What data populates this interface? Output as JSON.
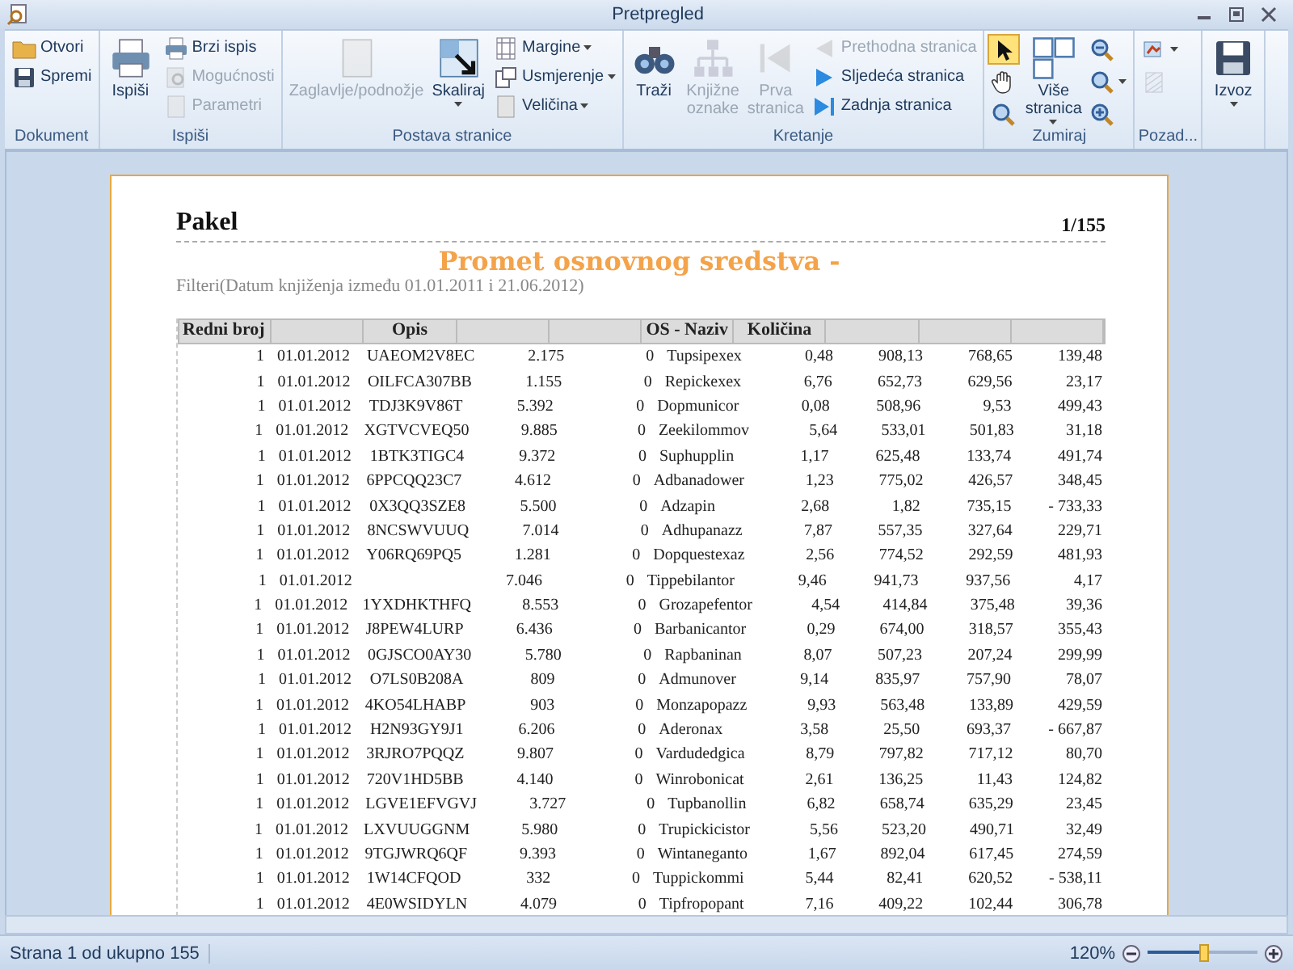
{
  "window": {
    "title": "Pretpregled"
  },
  "ribbon": {
    "groups": [
      {
        "label": "Dokument",
        "items": [
          {
            "kind": "small",
            "label": "Otvori",
            "disabled": false,
            "dropdown": false
          },
          {
            "kind": "small",
            "label": "Spremi",
            "disabled": false,
            "dropdown": false
          }
        ]
      },
      {
        "label": "Ispiši",
        "items": [
          {
            "kind": "large",
            "label": "Ispiši",
            "disabled": false,
            "dropdown": false
          },
          {
            "kind": "small",
            "label": "Brzi ispis",
            "disabled": false,
            "dropdown": false
          },
          {
            "kind": "small",
            "label": "Mogućnosti",
            "disabled": true,
            "dropdown": false
          },
          {
            "kind": "small",
            "label": "Parametri",
            "disabled": true,
            "dropdown": false
          }
        ]
      },
      {
        "label": "Postava stranice",
        "items": [
          {
            "kind": "large",
            "label": "Zaglavlje/podnožje",
            "disabled": true,
            "dropdown": false
          },
          {
            "kind": "large",
            "label": "Skaliraj",
            "disabled": false,
            "dropdown": true
          },
          {
            "kind": "small",
            "label": "Margine",
            "disabled": false,
            "dropdown": true
          },
          {
            "kind": "small",
            "label": "Usmjerenje",
            "disabled": false,
            "dropdown": true
          },
          {
            "kind": "small",
            "label": "Veličina",
            "disabled": false,
            "dropdown": true
          }
        ]
      },
      {
        "label": "Kretanje",
        "items": [
          {
            "kind": "large",
            "label": "Traži",
            "disabled": false,
            "dropdown": false
          },
          {
            "kind": "large",
            "label": "Knjižne oznake",
            "disabled": true,
            "dropdown": false
          },
          {
            "kind": "large",
            "label": "Prva stranica",
            "disabled": true,
            "dropdown": false
          },
          {
            "kind": "small",
            "label": "Prethodna stranica",
            "disabled": true,
            "dropdown": false
          },
          {
            "kind": "small",
            "label": "Sljedeća stranica",
            "disabled": false,
            "dropdown": false
          },
          {
            "kind": "small",
            "label": "Zadnja stranica",
            "disabled": false,
            "dropdown": false
          }
        ]
      },
      {
        "label": "Zumiraj",
        "items": [
          {
            "kind": "tool",
            "selected": true,
            "disabled": false,
            "dropdown": false
          },
          {
            "kind": "tool",
            "selected": false,
            "disabled": false,
            "dropdown": false
          },
          {
            "kind": "tool",
            "selected": false,
            "disabled": false,
            "dropdown": false
          },
          {
            "kind": "large",
            "label": "Više stranica",
            "disabled": false,
            "dropdown": true
          },
          {
            "kind": "tool",
            "selected": false,
            "disabled": false,
            "dropdown": false
          },
          {
            "kind": "tool",
            "selected": false,
            "disabled": false,
            "dropdown": true
          },
          {
            "kind": "tool",
            "selected": false,
            "disabled": false,
            "dropdown": false
          }
        ]
      },
      {
        "label": "Pozad...",
        "items": [
          {
            "kind": "tool",
            "selected": false,
            "disabled": false,
            "dropdown": true
          },
          {
            "kind": "tool",
            "selected": false,
            "disabled": true,
            "dropdown": false
          }
        ]
      },
      {
        "items": [
          {
            "kind": "large",
            "label": "Izvoz",
            "disabled": false,
            "dropdown": true
          }
        ]
      }
    ]
  },
  "document": {
    "company": "Pakel",
    "page_number": "1/155",
    "title": "Promet osnovnog sredstva -",
    "filter": "Filteri(Datum knjiženja između 01.01.2011 i 21.06.2012)",
    "table": {
      "columns": [
        "Redni broj",
        "",
        "Opis",
        "",
        "",
        "OS - Naziv",
        "Količina",
        "",
        "",
        ""
      ],
      "rows": [
        [
          "1",
          "01.01.2012",
          "UAEOM2V8EC",
          "2.175",
          "0",
          "Tupsipexex",
          "0,48",
          "908,13",
          "768,65",
          "139,48"
        ],
        [
          "1",
          "01.01.2012",
          "OILFCA307BB",
          "1.155",
          "0",
          "Repickexex",
          "6,76",
          "652,73",
          "629,56",
          "23,17"
        ],
        [
          "1",
          "01.01.2012",
          "TDJ3K9V86T",
          "5.392",
          "0",
          "Dopmunicor",
          "0,08",
          "508,96",
          "9,53",
          "499,43"
        ],
        [
          "1",
          "01.01.2012",
          "XGTVCVEQ50",
          "9.885",
          "0",
          "Zeekilommov",
          "5,64",
          "533,01",
          "501,83",
          "31,18"
        ],
        [
          "1",
          "01.01.2012",
          "1BTK3TIGC4",
          "9.372",
          "0",
          "Suphupplin",
          "1,17",
          "625,48",
          "133,74",
          "491,74"
        ],
        [
          "1",
          "01.01.2012",
          "6PPCQQ23C7",
          "4.612",
          "0",
          "Adbanadower",
          "1,23",
          "775,02",
          "426,57",
          "348,45"
        ],
        [
          "1",
          "01.01.2012",
          "0X3QQ3SZE8",
          "5.500",
          "0",
          "Adzapin",
          "2,68",
          "1,82",
          "735,15",
          "- 733,33"
        ],
        [
          "1",
          "01.01.2012",
          "8NCSWVUUQ",
          "7.014",
          "0",
          "Adhupanazz",
          "7,87",
          "557,35",
          "327,64",
          "229,71"
        ],
        [
          "1",
          "01.01.2012",
          "Y06RQ69PQ5",
          "1.281",
          "0",
          "Dopquestexaz",
          "2,56",
          "774,52",
          "292,59",
          "481,93"
        ],
        [
          "1",
          "01.01.2012",
          "",
          "7.046",
          "0",
          "Tippebilantor",
          "9,46",
          "941,73",
          "937,56",
          "4,17"
        ],
        [
          "1",
          "01.01.2012",
          "1YXDHKTHFQ",
          "8.553",
          "0",
          "Grozapefentor",
          "4,54",
          "414,84",
          "375,48",
          "39,36"
        ],
        [
          "1",
          "01.01.2012",
          "J8PEW4LURP",
          "6.436",
          "0",
          "Barbanicantor",
          "0,29",
          "674,00",
          "318,57",
          "355,43"
        ],
        [
          "1",
          "01.01.2012",
          "0GJSCO0AY30",
          "5.780",
          "0",
          "Rapbaninan",
          "8,07",
          "507,23",
          "207,24",
          "299,99"
        ],
        [
          "1",
          "01.01.2012",
          "O7LS0B208A",
          "809",
          "0",
          "Admunover",
          "9,14",
          "835,97",
          "757,90",
          "78,07"
        ],
        [
          "1",
          "01.01.2012",
          "4KO54LHABP",
          "903",
          "0",
          "Monzapopazz",
          "9,93",
          "563,48",
          "133,89",
          "429,59"
        ],
        [
          "1",
          "01.01.2012",
          "H2N93GY9J1",
          "6.206",
          "0",
          "Aderonax",
          "3,58",
          "25,50",
          "693,37",
          "- 667,87"
        ],
        [
          "1",
          "01.01.2012",
          "3RJRO7PQQZ",
          "9.807",
          "0",
          "Vardudedgica",
          "8,79",
          "797,82",
          "717,12",
          "80,70"
        ],
        [
          "1",
          "01.01.2012",
          "720V1HD5BB",
          "4.140",
          "0",
          "Winrobonicat",
          "2,61",
          "136,25",
          "11,43",
          "124,82"
        ],
        [
          "1",
          "01.01.2012",
          "LGVE1EFVGVJ",
          "3.727",
          "0",
          "Tupbanollin",
          "6,82",
          "658,74",
          "635,29",
          "23,45"
        ],
        [
          "1",
          "01.01.2012",
          "LXVUUGGNM",
          "5.980",
          "0",
          "Trupickicistor",
          "5,56",
          "523,20",
          "490,71",
          "32,49"
        ],
        [
          "1",
          "01.01.2012",
          "9TGJWRQ6QF",
          "9.393",
          "0",
          "Wintaneganto",
          "1,67",
          "892,04",
          "617,45",
          "274,59"
        ],
        [
          "1",
          "01.01.2012",
          "1W14CFQOD",
          "332",
          "0",
          "Tuppickommi",
          "5,44",
          "82,41",
          "620,52",
          "- 538,11"
        ],
        [
          "1",
          "01.01.2012",
          "4E0WSIDYLN",
          "4.079",
          "0",
          "Tipfropopant",
          "7,16",
          "409,22",
          "102,44",
          "306,78"
        ]
      ]
    }
  },
  "status_bar": {
    "page_info": "Strana 1 od ukupno 155",
    "zoom": "120%",
    "zoom_slider": {
      "level": 0.52
    }
  }
}
